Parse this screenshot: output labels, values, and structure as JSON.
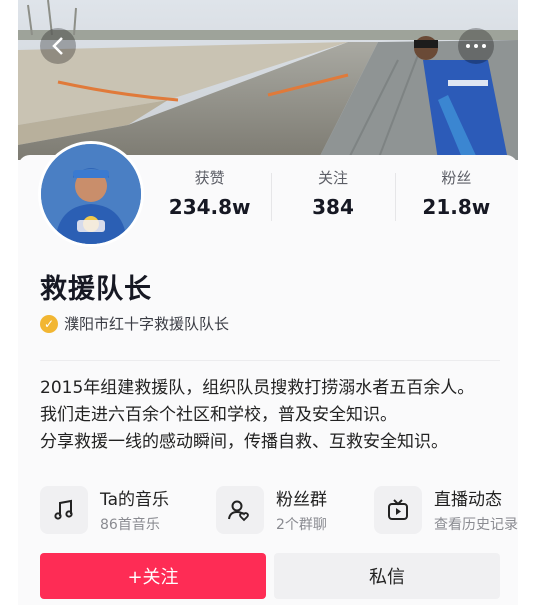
{
  "profile": {
    "name": "救援队长",
    "verification": "濮阳市红十字救援队队长"
  },
  "stats": [
    {
      "label": "获赞",
      "value": "234.8w"
    },
    {
      "label": "关注",
      "value": "384"
    },
    {
      "label": "粉丝",
      "value": "21.8w"
    }
  ],
  "bio": [
    "2015年组建救援队，组织队员搜救打捞溺水者五百余人。",
    "我们走进六百余个社区和学校，普及安全知识。",
    "分享救援一线的感动瞬间，传播自救、互救安全知识。"
  ],
  "shortcuts": [
    {
      "title": "Ta的音乐",
      "sub": "86首音乐",
      "icon": "music-note-icon"
    },
    {
      "title": "粉丝群",
      "sub": "2个群聊",
      "icon": "group-chat-icon"
    },
    {
      "title": "直播动态",
      "sub": "查看历史记录",
      "icon": "live-tv-icon"
    }
  ],
  "actions": {
    "follow": "+关注",
    "message": "私信"
  },
  "colors": {
    "follow_button": "#fe2c55",
    "verify_badge": "#f2b632"
  }
}
